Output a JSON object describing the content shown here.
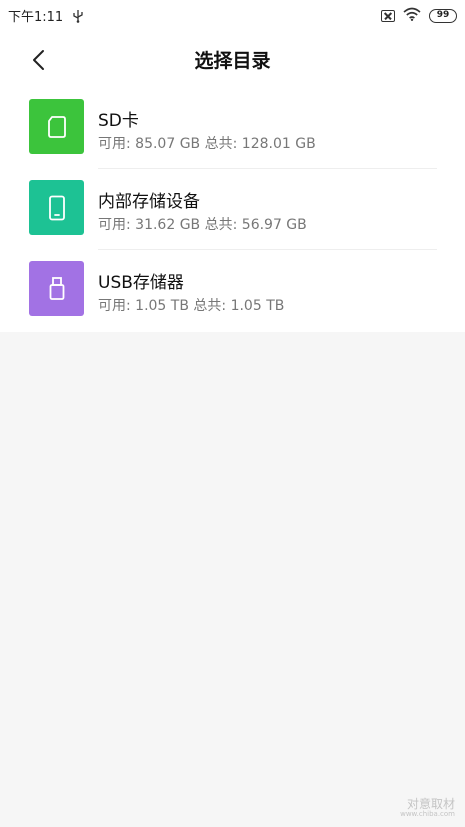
{
  "status_bar": {
    "time": "下午1:11",
    "battery_level": "99"
  },
  "header": {
    "title": "选择目录"
  },
  "storage_items": [
    {
      "name": "SD卡",
      "available_label": "可用:",
      "available": "85.07 GB",
      "total_label": "总共:",
      "total": "128.01 GB",
      "icon": "sd-card-icon",
      "color": "#3cc43c"
    },
    {
      "name": "内部存储设备",
      "available_label": "可用:",
      "available": "31.62 GB",
      "total_label": "总共:",
      "total": "56.97 GB",
      "icon": "phone-icon",
      "color": "#1dc294"
    },
    {
      "name": "USB存储器",
      "available_label": "可用:",
      "available": "1.05 TB",
      "total_label": "总共:",
      "total": "1.05 TB",
      "icon": "usb-drive-icon",
      "color": "#a272e4"
    }
  ],
  "watermark": {
    "main": "对意取材",
    "sub": "www.chiba.com"
  }
}
